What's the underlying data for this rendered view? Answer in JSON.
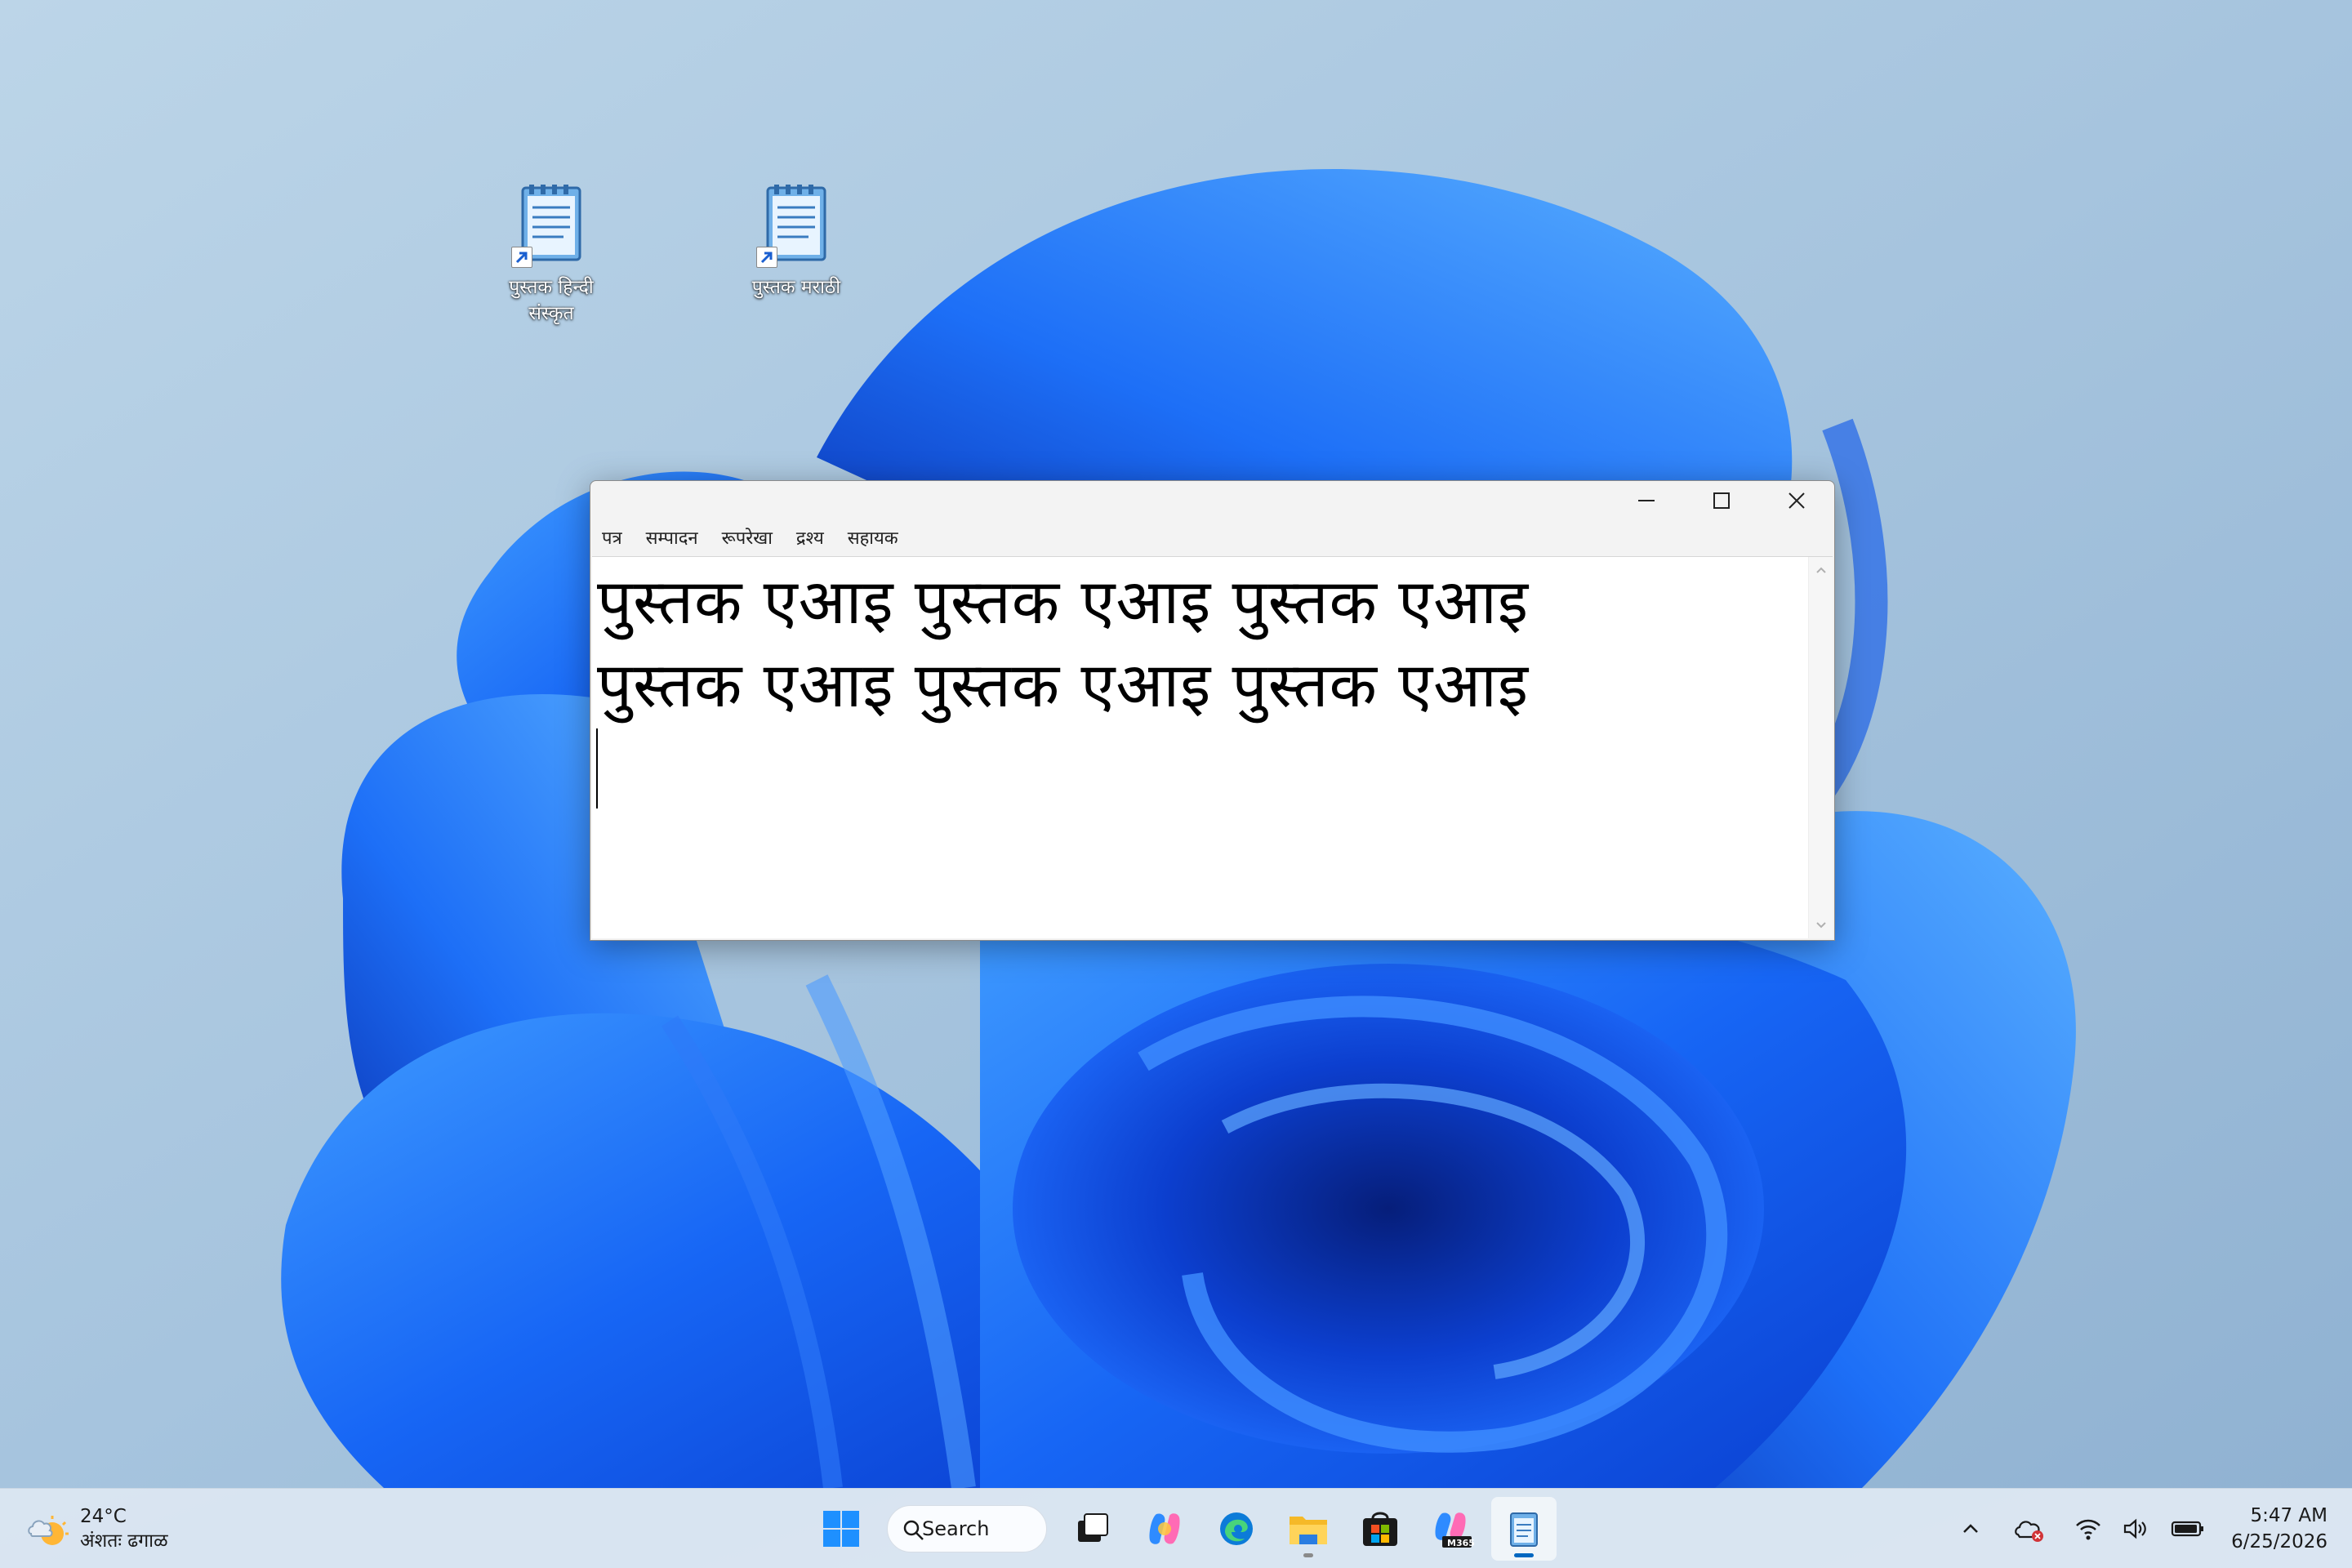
{
  "desktop": {
    "icons": [
      {
        "label_line1": "पुस्तक हिन्दी",
        "label_line2": "संस्कृत",
        "icon": "notepad-shortcut-icon"
      },
      {
        "label_line1": "पुस्तक मराठी",
        "label_line2": "",
        "icon": "notepad-shortcut-icon"
      }
    ]
  },
  "notepad": {
    "menu": [
      "पत्र",
      "सम्पादन",
      "रूपरेखा",
      "द्रश्य",
      "सहायक"
    ],
    "content": {
      "line1": "पुस्तक एआइ पुस्तक एआइ पुस्तक एआइ",
      "line2": "पुस्तक एआइ पुस्तक एआइ पुस्तक एआइ"
    },
    "controls": {
      "minimize": "minimize-icon",
      "maximize": "maximize-icon",
      "close": "close-icon"
    }
  },
  "taskbar": {
    "weather": {
      "temp": "24°C",
      "condition": "अंशतः ढगाळ",
      "icon": "partly-cloudy-icon"
    },
    "search_label": "Search",
    "apps": [
      "start-icon",
      "search-icon",
      "task-view-icon",
      "copilot-icon",
      "edge-icon",
      "file-explorer-icon",
      "store-icon",
      "m365-icon",
      "notepad-icon"
    ],
    "m365_badge": "M365",
    "tray": [
      "chevron-up-icon",
      "onedrive-error-icon",
      "wifi-icon",
      "volume-icon",
      "battery-icon"
    ],
    "time": "5:47 AM",
    "date": "6/25/2026"
  },
  "colors": {
    "accent": "#0067c0",
    "bloom": "#1a5cf0"
  }
}
